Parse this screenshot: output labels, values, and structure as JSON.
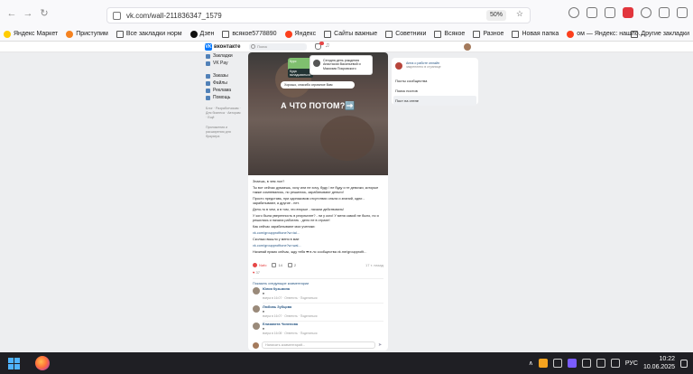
{
  "browser": {
    "url": "vk.com/wall-211836347_1579",
    "zoom": "50%",
    "bookmarks": [
      {
        "label": "Яндекс Маркет",
        "icon": "yandex-market-icon"
      },
      {
        "label": "Приступим",
        "icon": "bookmark-icon"
      },
      {
        "label": "Все закладки норм",
        "icon": "folder-icon"
      },
      {
        "label": "Дзен",
        "icon": "zen-icon"
      },
      {
        "label": "всякое5778890",
        "icon": "folder-icon"
      },
      {
        "label": "Яндекс",
        "icon": "yandex-icon"
      },
      {
        "label": "Сайты важные",
        "icon": "folder-icon"
      },
      {
        "label": "Советники",
        "icon": "folder-icon"
      },
      {
        "label": "Всякое",
        "icon": "folder-icon"
      },
      {
        "label": "Разное",
        "icon": "folder-icon"
      },
      {
        "label": "Новая папка",
        "icon": "folder-icon"
      },
      {
        "label": "ом — Яндекс: нашло...",
        "icon": "yandex-icon"
      }
    ],
    "bookmarks_more": "Другие закладки"
  },
  "vk": {
    "logo_text": "вконтакте",
    "search_placeholder": "Поиск",
    "menu": [
      {
        "label": "Закладки"
      },
      {
        "label": "VK Pay"
      },
      {
        "label": "Заказы"
      },
      {
        "label": "Файлы"
      },
      {
        "label": "Реклама"
      },
      {
        "label": "Помощь"
      }
    ],
    "footer_text": "Блог · Разработчикам · Для бизнеса · Авторам · Ещё",
    "footer_text2": "Приложения и расширения для браузера",
    "post": {
      "chat_green": "Курс",
      "chat_dark": "Куда вкладываться",
      "notif_title": "Сегодня день рождения",
      "notif_text": "Анастасии Васильевой и Максима Покровского",
      "bubble": "Хорошо, спасибо огромное Вам",
      "headline": "А ЧТО ПОТОМ?➡️",
      "text": [
        "Знаешь, в чем лол?",
        "Ты вот сейчас думаешь, хочу или не хочу, буду / не буду и те девочки, которые также сомневались, но решились, зарабатывают деньги!",
        "Просто представь, при одинаковом отсутствии опыта и знаний, одни - зарабатывают, а другие - нет.",
        "Дело-то в чем, а в том, что вторые - начали действовать!",
        "У кого была уверенность в результате? - ни у кого! У меня самой не было, но я решилась и начала работать - дело не в страхе!",
        "Как сейчас зарабатывают мои ученики:",
        "vk.com/groupprofitone?w=tal...",
        "Сколько вышло у меня в мае",
        "vk.com/groupprofitone?w=wal...",
        "Начинай прямо сейчас, жду тебя ➡ в лс сообщества vk.me/groupprofit..."
      ],
      "like_label": "Nafo",
      "comments_count": "14",
      "reposts_count": "2",
      "views": "17 т. назад",
      "views_count": "37",
      "comments_more": "Показать следующие комментарии",
      "comments": [
        {
          "name": "Юлия Кузьмина",
          "text": "♦",
          "meta": "вчера в 16:07 · Ответить · Поделиться"
        },
        {
          "name": "Любовь Зубцова",
          "text": "♦",
          "meta": "вчера в 16:07 · Ответить · Поделиться"
        },
        {
          "name": "Елизавета Чиненова",
          "text": "♦",
          "meta": "вчера в 16:08 · Ответить · Поделиться"
        }
      ],
      "comment_placeholder": "Написать комментарий..."
    },
    "right": {
      "author_line1": "Анна о работе онлайн",
      "author_line2": "закреплено в странице",
      "links": [
        "Посты сообщества",
        "Поиск постов",
        "Пост на стене"
      ]
    }
  },
  "taskbar": {
    "lang": "РУС",
    "time": "10:22",
    "date": "10.06.2025"
  }
}
